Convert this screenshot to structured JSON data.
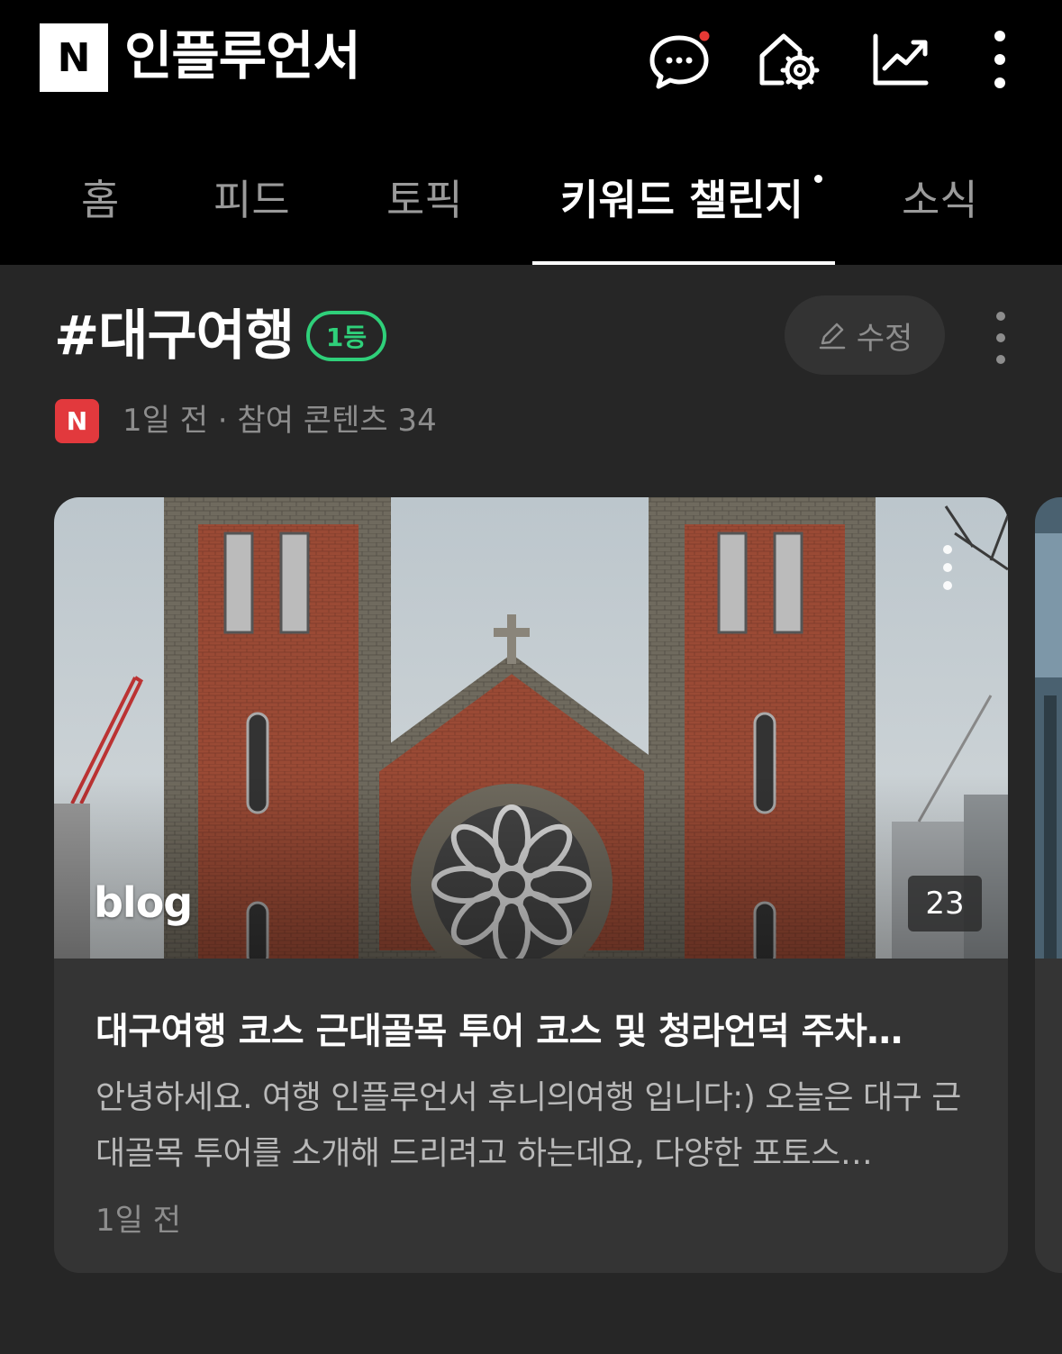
{
  "header": {
    "logo": "N",
    "title": "인플루언서"
  },
  "tabs": [
    {
      "label": "홈"
    },
    {
      "label": "피드"
    },
    {
      "label": "토픽"
    },
    {
      "label": "키워드 챌린지",
      "active": true
    },
    {
      "label": "소식"
    }
  ],
  "keyword": {
    "hashtag": "#대구여행",
    "rank": "1등",
    "edit_label": "수정",
    "source_logo": "N",
    "meta": "1일 전 · 참여 콘텐츠 34"
  },
  "card": {
    "source": "blog",
    "image_count": "23",
    "title": "대구여행 코스 근대골목 투어 코스 및 청라언덕 주차…",
    "description": "안녕하세요. 여행 인플루언서 후니의여행 입니다:) 오늘은 대구 근대골목 투어를 소개해 드리려고 하는데요, 다양한 포토스…",
    "time": "1일 전"
  },
  "colors": {
    "background": "#262626",
    "topbar": "#000000",
    "rank_green": "#2fd07a",
    "notification_red": "#e53935",
    "source_red": "#e2393d"
  },
  "icons": [
    "chat-icon",
    "home-settings-icon",
    "stats-chart-icon",
    "more-vertical-icon",
    "pencil-icon"
  ]
}
